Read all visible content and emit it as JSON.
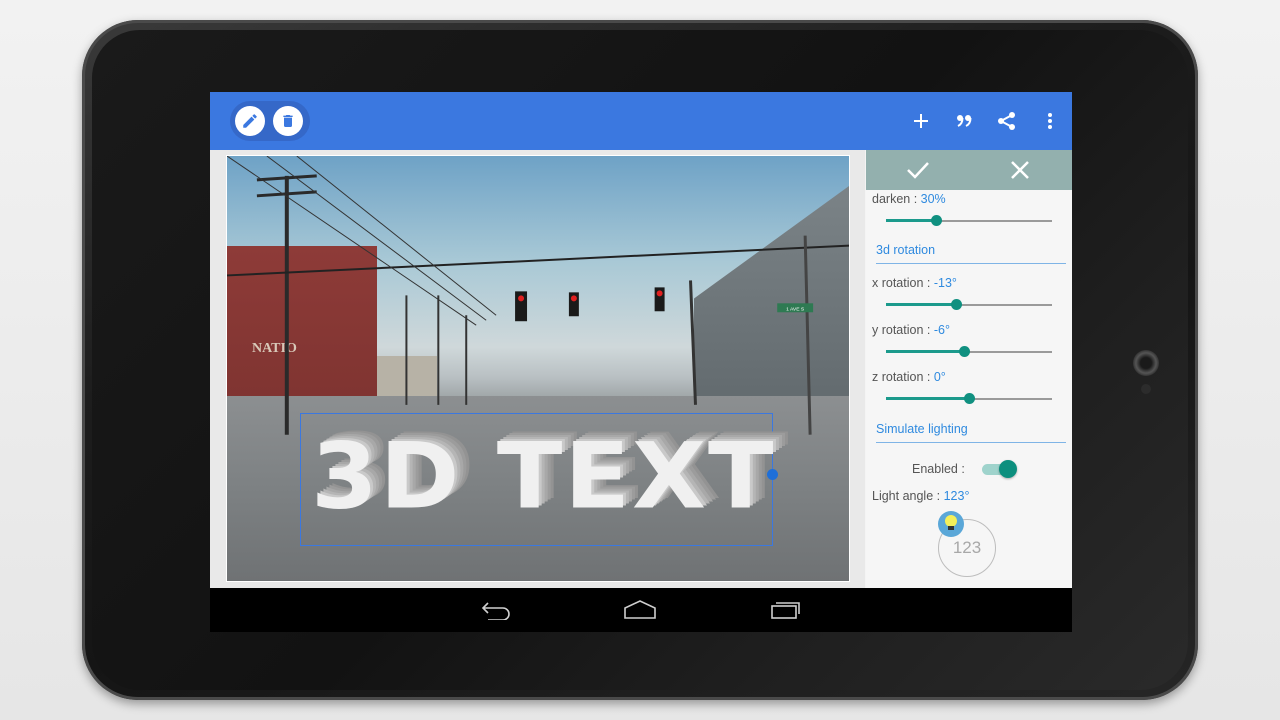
{
  "device": {
    "type": "Android tablet"
  },
  "appbar": {
    "left_actions": [
      {
        "name": "edit",
        "icon": "pencil-icon"
      },
      {
        "name": "delete",
        "icon": "trash-icon"
      }
    ],
    "right_actions": [
      {
        "name": "add",
        "icon": "plus-icon"
      },
      {
        "name": "quote",
        "icon": "quote-icon"
      },
      {
        "name": "share",
        "icon": "share-icon"
      },
      {
        "name": "more",
        "icon": "more-vert-icon"
      }
    ],
    "color": "#3b78e0"
  },
  "canvas": {
    "overlay_text": "3D TEXT",
    "street_sign": "1 AVE S",
    "building_sign": "NATIO"
  },
  "panel": {
    "confirm_icon": "check-icon",
    "cancel_icon": "close-icon",
    "darken": {
      "label": "darken : ",
      "value": "30%",
      "fraction": 0.3
    },
    "rotation_section": "3d rotation",
    "x_rotation": {
      "label": "x rotation : ",
      "value": "-13°",
      "fraction": 0.42
    },
    "y_rotation": {
      "label": "y rotation : ",
      "value": "-6°",
      "fraction": 0.47
    },
    "z_rotation": {
      "label": "z rotation : ",
      "value": "0°",
      "fraction": 0.5
    },
    "lighting_section": "Simulate lighting",
    "enabled": {
      "label": "Enabled :",
      "on": true
    },
    "light_angle": {
      "label": "Light angle : ",
      "value": "123°"
    },
    "dial_value": "123",
    "accent": "#1b9a8c",
    "value_color": "#2f8adf"
  },
  "navbar": {
    "buttons": [
      {
        "name": "back",
        "icon": "back-icon"
      },
      {
        "name": "home",
        "icon": "home-icon"
      },
      {
        "name": "recents",
        "icon": "recents-icon"
      }
    ]
  }
}
